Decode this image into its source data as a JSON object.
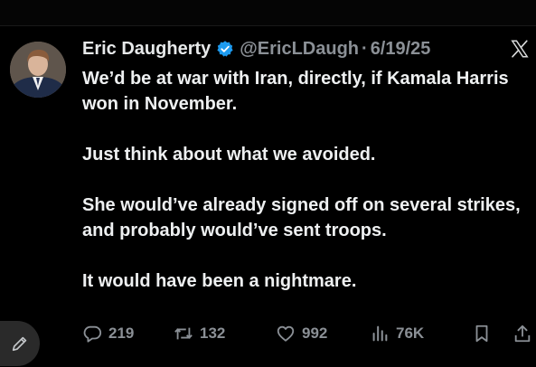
{
  "tweet": {
    "author_name": "Eric Daugherty",
    "handle": "@EricLDaugh",
    "separator": "·",
    "date": "6/19/25",
    "paragraphs": [
      "We’d be at war with Iran, directly, if Kamala Harris won in November.",
      "Just think about what we avoided.",
      "She would’ve already signed off on several strikes, and probably would’ve sent troops.",
      "It would have been a nightmare."
    ]
  },
  "actions": {
    "replies": "219",
    "retweets": "132",
    "likes": "992",
    "views": "76K"
  },
  "icons": {
    "verified": "verified-badge-icon",
    "platform": "x-logo-icon",
    "reply": "reply-icon",
    "retweet": "retweet-icon",
    "like": "heart-icon",
    "views": "views-icon",
    "bookmark": "bookmark-icon",
    "share": "share-icon",
    "compose": "compose-icon"
  },
  "colors": {
    "background": "#000000",
    "text": "#e7e9ea",
    "secondary_text": "#8b9096",
    "verified_blue": "#1d9bf0"
  }
}
